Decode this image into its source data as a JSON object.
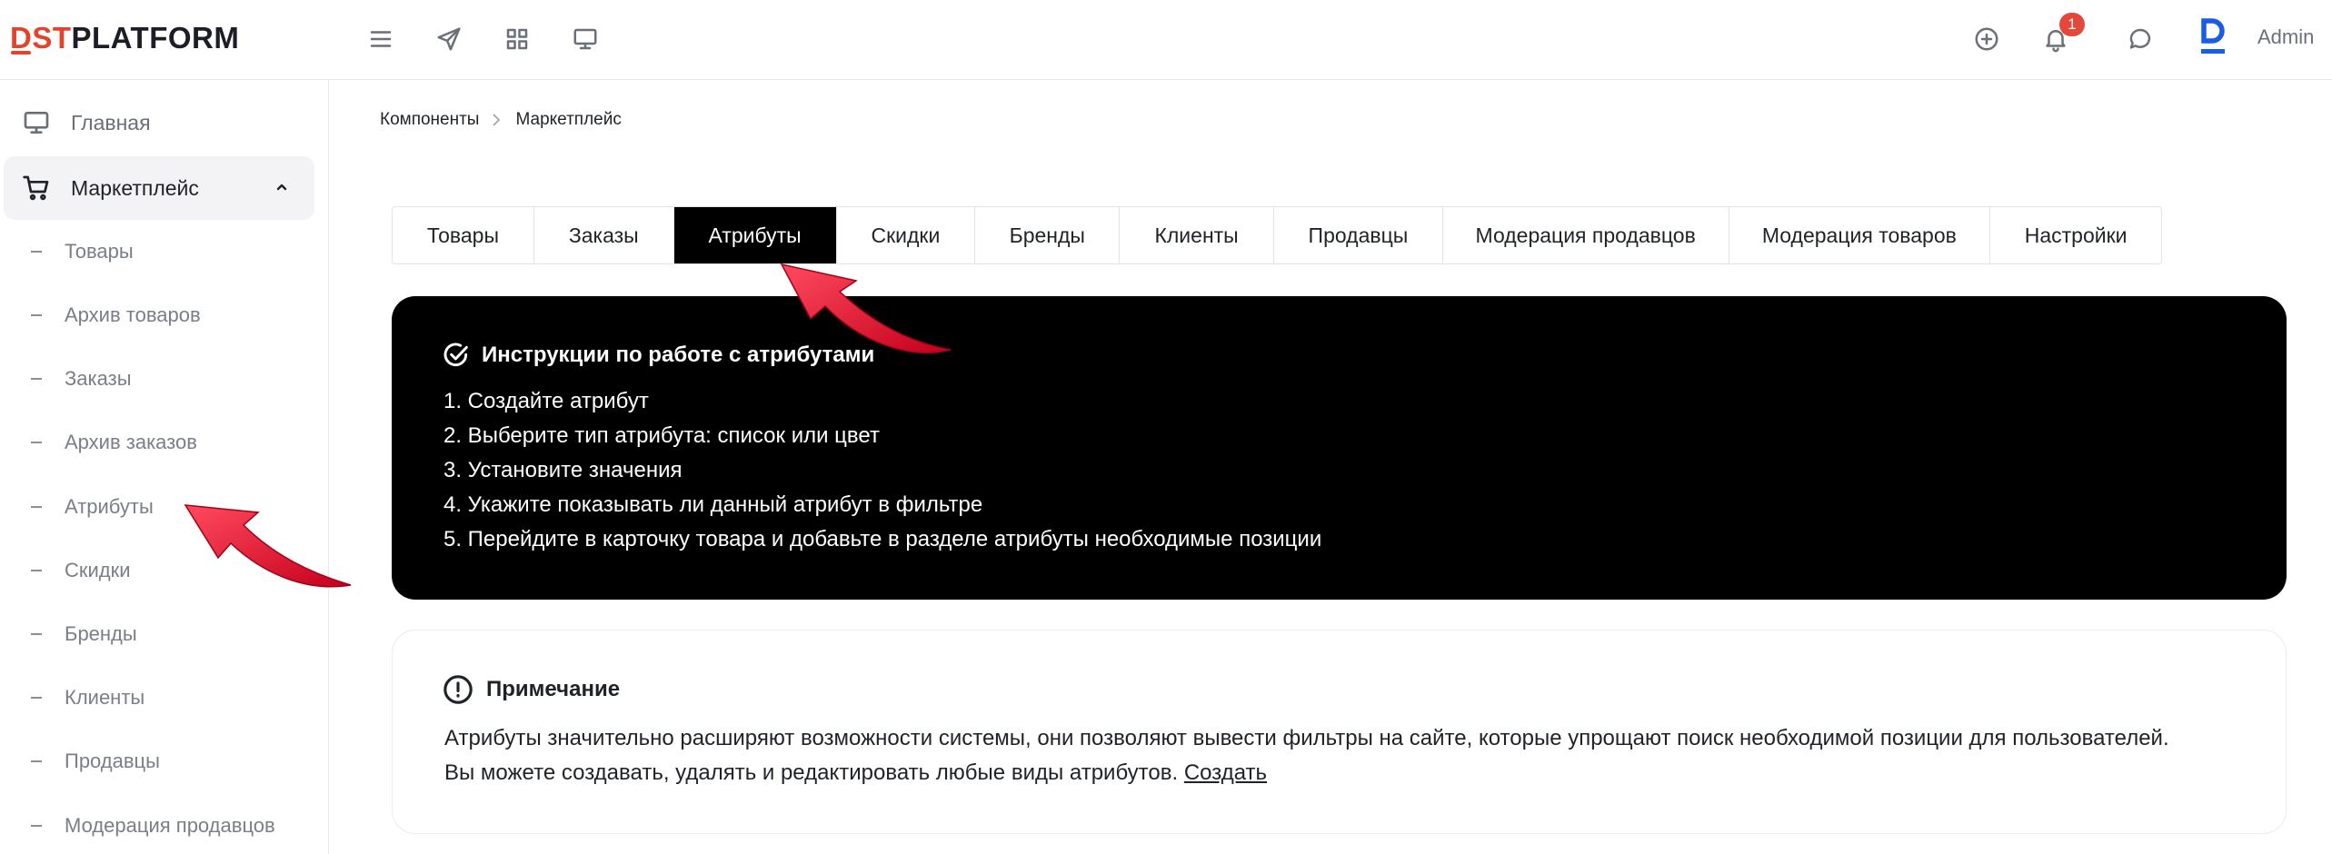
{
  "header": {
    "logo_part1": "DST",
    "logo_part2": "PLATFORM",
    "notification_count": "1",
    "user_name": "Admin",
    "accent_color": "#e4432a"
  },
  "sidebar": {
    "home_label": "Главная",
    "section_label": "Маркетплейс",
    "items": [
      {
        "label": "Товары"
      },
      {
        "label": "Архив товаров"
      },
      {
        "label": "Заказы"
      },
      {
        "label": "Архив заказов"
      },
      {
        "label": "Атрибуты"
      },
      {
        "label": "Скидки"
      },
      {
        "label": "Бренды"
      },
      {
        "label": "Клиенты"
      },
      {
        "label": "Продавцы"
      },
      {
        "label": "Модерация продавцов"
      }
    ]
  },
  "breadcrumb": {
    "parent": "Компоненты",
    "current": "Маркетплейс"
  },
  "tabs": [
    {
      "label": "Товары"
    },
    {
      "label": "Заказы"
    },
    {
      "label": "Атрибуты",
      "active": true
    },
    {
      "label": "Скидки"
    },
    {
      "label": "Бренды"
    },
    {
      "label": "Клиенты"
    },
    {
      "label": "Продавцы"
    },
    {
      "label": "Модерация продавцов"
    },
    {
      "label": "Модерация товаров"
    },
    {
      "label": "Настройки"
    }
  ],
  "instructions": {
    "title": "Инструкции по работе с атрибутами",
    "steps": [
      "1. Создайте атрибут",
      "2. Выберите тип атрибута: список или цвет",
      "3. Установите значения",
      "4. Укажите показывать ли данный атрибут в фильтре",
      "5. Перейдите в карточку товара и добавьте в разделе атрибуты необходимые позиции"
    ]
  },
  "note": {
    "title": "Примечание",
    "text": "Атрибуты значительно расширяют возможности системы, они позволяют вывести фильтры на сайте, которые упрощают поиск необходимой позиции для пользователей. Вы можете создавать, удалять и редактировать любые виды атрибутов.",
    "link_label": "Создать"
  }
}
